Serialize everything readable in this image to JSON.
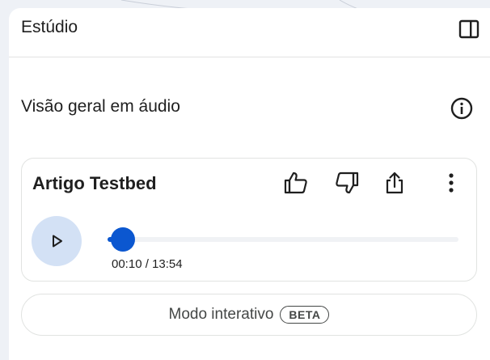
{
  "panel": {
    "title": "Estúdio",
    "collapse_icon": "side-panel-icon"
  },
  "audio_overview": {
    "section_title": "Visão geral em áudio",
    "info_icon": "info-icon",
    "card": {
      "title": "Artigo Testbed",
      "actions": [
        "thumb-up-icon",
        "thumb-down-icon",
        "share-icon",
        "more-vert-icon"
      ],
      "current_time": "00:10",
      "total_time": "13:54",
      "time_display": "00:10 / 13:54",
      "progress": 0.012
    }
  },
  "interactive_mode": {
    "label": "Modo interativo",
    "badge": "BETA"
  },
  "colors": {
    "accent": "#0b57d0",
    "play_button_bg": "#d3e1f5",
    "border": "#e1e3e1",
    "text": "#1f1f1f"
  }
}
